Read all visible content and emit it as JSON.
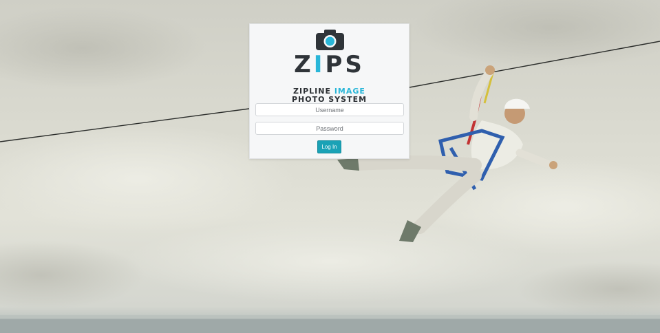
{
  "brand": {
    "logo_text_left": "Z",
    "logo_text_accent": "I",
    "logo_text_right": "PS",
    "tagline_line1_part1": "ZIPLINE ",
    "tagline_line1_accent": "IMAGE",
    "tagline_line2": "PHOTO SYSTEM",
    "accent_color": "#29b6d8",
    "camera_icon": "camera-icon"
  },
  "form": {
    "username_placeholder": "Username",
    "password_placeholder": "Password",
    "login_label": "Log In",
    "button_color": "#1aa2b6"
  }
}
